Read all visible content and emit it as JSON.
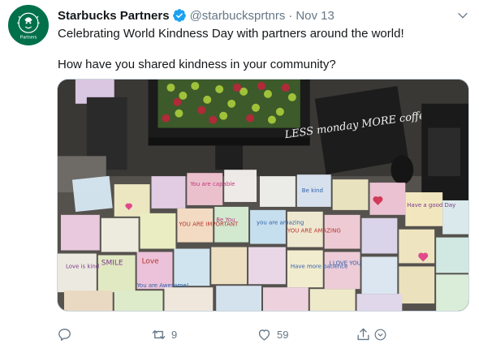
{
  "tweet": {
    "display_name": "Starbucks Partners",
    "handle": "@starbucksprtnrs",
    "separator": "·",
    "date": "Nov 13",
    "text_line1": "Celebrating World Kindness Day with partners around the world!",
    "text_line2": "How have you shared kindness in your community?",
    "avatar_label": "Partners",
    "photo_sign_text": "LESS monday MORE coffee",
    "note_snippets": [
      "You are capable",
      "Be kind",
      "YOU ARE IMPORTANT",
      "SMILE",
      "You are Awesome!",
      "Love",
      "I LOVE YOU",
      "Have a good Day",
      "you are amazing",
      "Be You",
      "Love is kind",
      "Have more patience",
      "YOU ARE AMAZING"
    ]
  },
  "actions": {
    "reply_icon": "reply-icon",
    "retweet_icon": "retweet-icon",
    "retweet_count": "9",
    "like_icon": "heart-icon",
    "like_count": "59",
    "share_icon": "share-icon"
  },
  "colors": {
    "verified": "#1da1f2",
    "brand_green": "#00704a",
    "muted_text": "#657786"
  }
}
